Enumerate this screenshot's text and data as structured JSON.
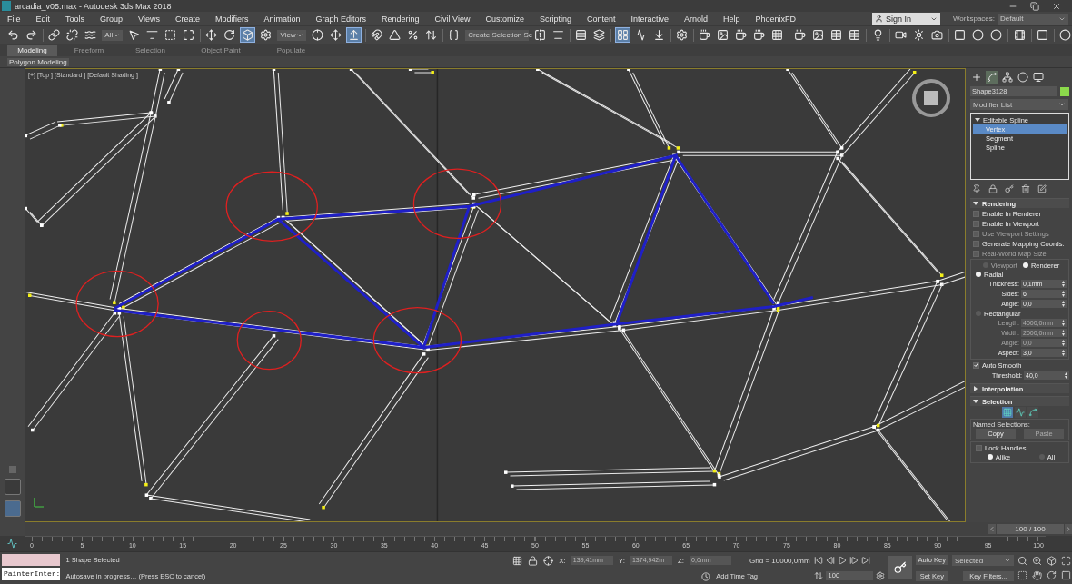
{
  "window": {
    "title": "arcadia_v05.max - Autodesk 3ds Max 2018"
  },
  "menu": [
    "File",
    "Edit",
    "Tools",
    "Group",
    "Views",
    "Create",
    "Modifiers",
    "Animation",
    "Graph Editors",
    "Rendering",
    "Civil View",
    "Customize",
    "Scripting",
    "Content",
    "Interactive",
    "Arnold",
    "Help",
    "PhoenixFD"
  ],
  "account": {
    "sign_in": "Sign In",
    "workspaces_label": "Workspaces:",
    "workspace": "Default"
  },
  "toolbar": {
    "selection_filter": "All",
    "reference_coord": "View",
    "named_selection": "Create Selection Se"
  },
  "ribbon": {
    "tabs": [
      {
        "label": "Modeling",
        "selected": true
      },
      {
        "label": "Freeform",
        "selected": false
      },
      {
        "label": "Selection",
        "selected": false
      },
      {
        "label": "Object Paint",
        "selected": false
      },
      {
        "label": "Populate",
        "selected": false
      }
    ],
    "panel": "Polygon Modeling"
  },
  "viewport": {
    "label": "[+] [Top ] [Standard ] [Default Shading ]"
  },
  "command_panel": {
    "tabs": [
      {
        "selected": false
      },
      {
        "selected": true
      },
      {
        "selected": false
      },
      {
        "selected": false
      },
      {
        "selected": false
      }
    ],
    "object_name": "Shape3128",
    "modifier_list": "Modifier List",
    "stack": [
      {
        "label": "Editable Spline",
        "expanded": true,
        "selected": false,
        "children": [
          {
            "label": "Vertex",
            "selected": true
          },
          {
            "label": "Segment",
            "selected": false
          },
          {
            "label": "Spline",
            "selected": false
          }
        ]
      }
    ],
    "rollouts": [
      {
        "kind": "rendering",
        "title": "Rendering",
        "expanded": true,
        "options": [
          {
            "label": "Enable In Renderer",
            "checked": false,
            "disabled": false
          },
          {
            "label": "Enable In Viewport",
            "checked": false,
            "disabled": false
          },
          {
            "label": "Use Viewport Settings",
            "checked": false,
            "disabled": true
          },
          {
            "label": "Generate Mapping Coords.",
            "checked": false,
            "disabled": false
          },
          {
            "label": "Real-World Map Size",
            "checked": false,
            "disabled": true
          }
        ],
        "mode": [
          {
            "label": "Viewport",
            "selected": false,
            "disabled": true
          },
          {
            "label": "Renderer",
            "selected": true,
            "disabled": false
          }
        ],
        "shapes": [
          {
            "label": "Radial",
            "selected": true,
            "params": [
              {
                "label": "Thickness:",
                "value": "0,1mm",
                "disabled": false
              },
              {
                "label": "Sides:",
                "value": "6",
                "disabled": false
              },
              {
                "label": "Angle:",
                "value": "0,0",
                "disabled": false
              }
            ]
          },
          {
            "label": "Rectangular",
            "selected": false,
            "params": [
              {
                "label": "Length:",
                "value": "4000,0mm",
                "disabled": true
              },
              {
                "label": "Width:",
                "value": "2000,0mm",
                "disabled": true
              },
              {
                "label": "Angle:",
                "value": "0,0",
                "disabled": true
              },
              {
                "label": "Aspect:",
                "value": "3,0",
                "disabled": false
              }
            ]
          }
        ],
        "auto_smooth": {
          "label": "Auto Smooth",
          "checked": true
        },
        "threshold": {
          "label": "Threshold:",
          "value": "40,0"
        }
      },
      {
        "title": "Interpolation",
        "expanded": false
      },
      {
        "kind": "selection",
        "title": "Selection",
        "expanded": true,
        "subobjects": [
          {
            "selected": true
          },
          {
            "selected": false
          },
          {
            "selected": false
          }
        ],
        "named_label": "Named Selections:",
        "buttons": [
          {
            "label": "Copy",
            "disabled": false
          },
          {
            "label": "Paste",
            "disabled": true
          }
        ],
        "lock_handles": {
          "label": "Lock Handles",
          "checked": false
        },
        "handle_modes": [
          {
            "label": "Alike",
            "selected": true
          },
          {
            "label": "All",
            "selected": false
          }
        ]
      }
    ]
  },
  "timeline": {
    "slider": {
      "label": "100 / 100",
      "level": 1
    },
    "ticks": [
      "0",
      "5",
      "10",
      "15",
      "20",
      "25",
      "30",
      "35",
      "40",
      "45",
      "50",
      "55",
      "60",
      "65",
      "70",
      "75",
      "80",
      "85",
      "90",
      "95",
      "100"
    ]
  },
  "status": {
    "script_listener": "PainterInter:",
    "prompt": "1 Shape Selected",
    "message": "Autosave in progress… (Press ESC to cancel)",
    "coords": [
      {
        "label": "X:",
        "value": "139,41mm"
      },
      {
        "label": "Y:",
        "value": "1374,942m"
      },
      {
        "label": "Z:",
        "value": "0,0mm"
      }
    ],
    "grid": "Grid = 10000,0mm",
    "time_tag": "Add Time Tag",
    "frame": "100",
    "auto_key": "Auto Key",
    "key_mode": "Selected",
    "set_key": "Set Key",
    "key_filters": "Key Filters..."
  }
}
